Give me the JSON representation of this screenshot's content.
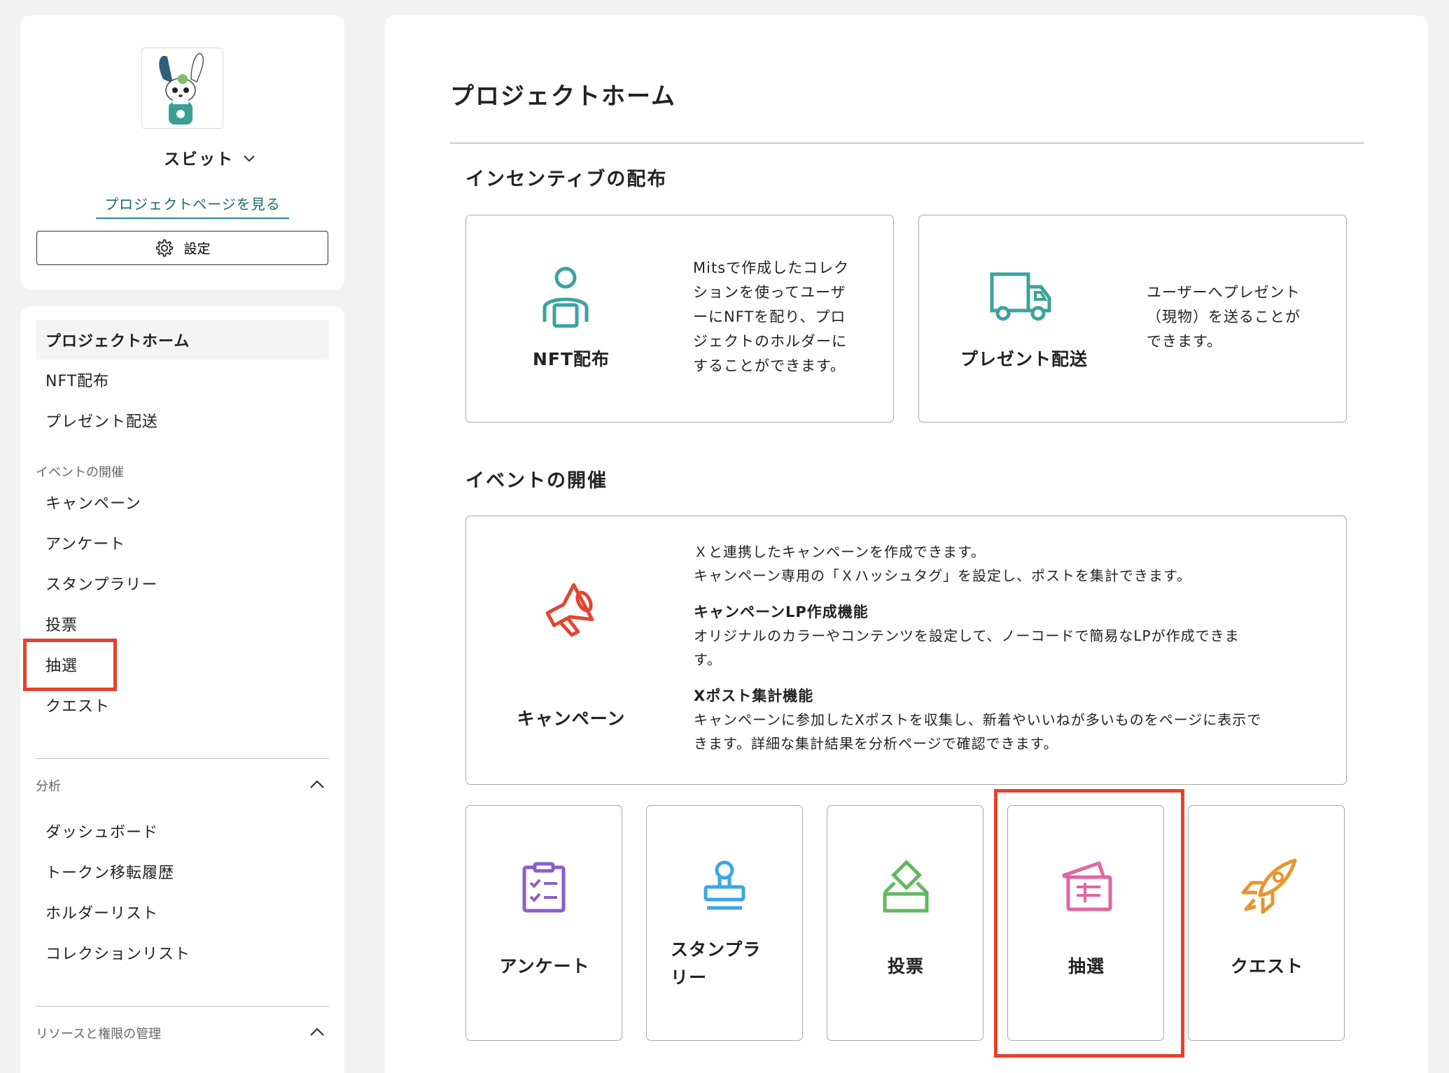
{
  "sidebar": {
    "project_name": "スビット",
    "project_link": "プロジェクトページを見る",
    "settings_label": "設定",
    "nav_top": [
      {
        "label": "プロジェクトホーム"
      },
      {
        "label": "NFT配布"
      },
      {
        "label": "プレゼント配送"
      }
    ],
    "events_heading": "イベントの開催",
    "events": [
      {
        "label": "キャンペーン"
      },
      {
        "label": "アンケート"
      },
      {
        "label": "スタンプラリー"
      },
      {
        "label": "投票"
      },
      {
        "label": "抽選"
      },
      {
        "label": "クエスト"
      }
    ],
    "analysis_heading": "分析",
    "analysis": [
      {
        "label": "ダッシュボード"
      },
      {
        "label": "トークン移転履歴"
      },
      {
        "label": "ホルダーリスト"
      },
      {
        "label": "コレクションリスト"
      }
    ],
    "resources_heading": "リソースと権限の管理"
  },
  "main": {
    "title": "プロジェクトホーム",
    "incentive_heading": "インセンティブの配布",
    "incentive_cards": [
      {
        "label": "NFT配布",
        "description": [
          "Mitsで作成したコレク",
          "ションを使ってユーザ",
          "ーにNFTを配り、プロ",
          "ジェクトのホルダーに",
          "することができます。"
        ]
      },
      {
        "label": "プレゼント配送",
        "description": [
          "ユーザーへプレゼント",
          "（現物）を送ることが",
          "できます。"
        ]
      }
    ],
    "events_heading": "イベントの開催",
    "campaign": {
      "label": "キャンペーン",
      "intro": [
        "Ｘと連携したキャンペーンを作成できます。",
        "キャンペーン専用の「Ｘハッシュタグ」を設定し、ポストを集計できます。"
      ],
      "feature1_title": "キャンペーンLP作成機能",
      "feature1_body": [
        "オリジナルのカラーやコンテンツを設定して、ノーコードで簡易なLPが作成できま",
        "す。"
      ],
      "feature2_title": "Xポスト集計機能",
      "feature2_body": [
        "キャンペーンに参加したXポストを収集し、新着やいいねが多いものをページに表示で",
        "きます。詳細な集計結果を分析ページで確認できます。"
      ]
    },
    "event_cards": [
      {
        "label": "アンケート",
        "icon": "clipboard-checklist-icon"
      },
      {
        "label_lines": [
          "スタンプラ",
          "リー"
        ],
        "icon": "stamp-icon"
      },
      {
        "label": "投票",
        "icon": "ballot-box-icon"
      },
      {
        "label": "抽選",
        "icon": "lottery-ticket-icon"
      },
      {
        "label": "クエスト",
        "icon": "rocket-icon"
      }
    ]
  },
  "colors": {
    "highlight": "#e5412c",
    "teal": "#3aa39c",
    "megaphone": "#e2452f",
    "survey": "#8c5ec9",
    "stamp": "#3ba6e3",
    "vote": "#62b95e",
    "lottery": "#e0669f",
    "quest": "#e8942f",
    "link": "#1a6a6a"
  }
}
